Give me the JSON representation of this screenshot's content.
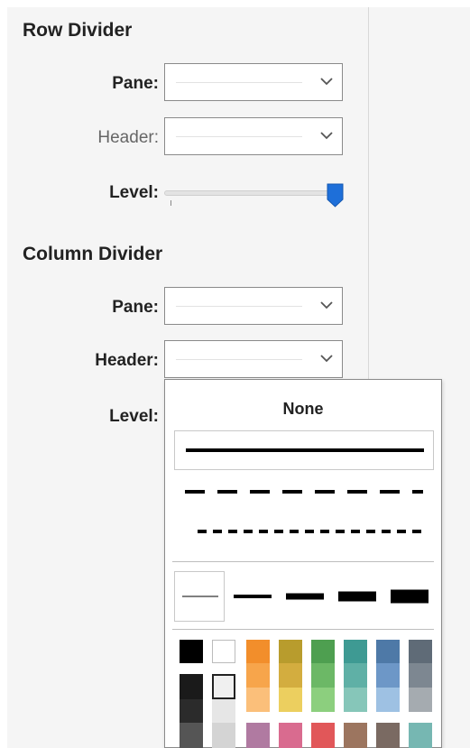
{
  "row_divider": {
    "title": "Row Divider",
    "pane_label": "Pane:",
    "header_label": "Header:",
    "level_label": "Level:"
  },
  "column_divider": {
    "title": "Column Divider",
    "pane_label": "Pane:",
    "header_label": "Header:",
    "level_label": "Level:"
  },
  "row_level_slider": {
    "value_fraction": 1.0
  },
  "line_style_popup": {
    "none_label": "None",
    "line_styles": [
      "solid",
      "dashed",
      "dotted"
    ],
    "selected_style": "solid",
    "line_weights": [
      "thinnest",
      "thin",
      "medium",
      "thick",
      "thickest"
    ],
    "selected_weight": "thinnest"
  },
  "colors": {
    "accent": "#1e6fd9",
    "panel_bg": "#f5f5f5",
    "grays": [
      "#000000",
      "#ffffff",
      "#1a1a1a",
      "#f0f0f0",
      "#2b2b2b",
      "#e6e6e6",
      "#555555",
      "#d4d4d4"
    ],
    "palette_top": [
      "#f28e2b",
      "#b89c2d",
      "#4e9f50",
      "#3e9a93",
      "#4e79a7",
      "#5f6b77"
    ],
    "palette_mid": [
      "#f7a54b",
      "#d3ad3f",
      "#6cb866",
      "#5fb0a6",
      "#6d97c7",
      "#7d8791"
    ],
    "palette_low": [
      "#fbbf7a",
      "#eccf5f",
      "#8ccf7e",
      "#86c6b9",
      "#9ec1e3",
      "#a5abb0"
    ],
    "palette_bottom": [
      "#b07aa1",
      "#d96b8f",
      "#e15759",
      "#9c755f",
      "#7a6a62",
      "#76b7b2"
    ]
  }
}
